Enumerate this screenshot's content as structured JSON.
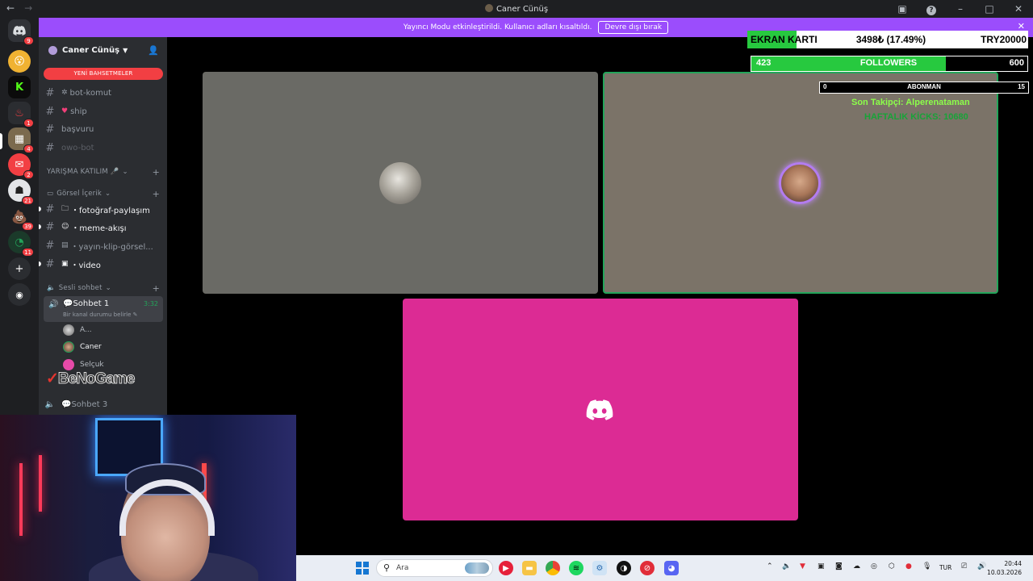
{
  "window": {
    "title": "Caner Cünüş"
  },
  "banner": {
    "message": "Yayıncı Modu etkinleştirildi. Kullanıcı adları kısaltıldı.",
    "button": "Devre dışı bırak"
  },
  "server_rail": {
    "badges": [
      "9",
      "1",
      "4",
      "2",
      "21",
      "39",
      "11"
    ]
  },
  "server": {
    "name": "Caner Cünüş"
  },
  "sidebar": {
    "mentions_pill": "YENİ BAHSETMELER",
    "channels_top": [
      {
        "label": "bot-komut",
        "prefix": "✲"
      },
      {
        "label": "ship",
        "prefix": "♥"
      },
      {
        "label": "başvuru"
      },
      {
        "label": "owo-bot"
      }
    ],
    "category_1": "YARIŞMA KATILIM 🎤",
    "category_2": "Görsel İçerik",
    "channels_visual": [
      {
        "label": "・fotoğraf-paylaşım"
      },
      {
        "label": "・meme-akışı"
      },
      {
        "label": "・yayın-klip-görsel..."
      },
      {
        "label": "・video"
      }
    ],
    "category_3": "Sesli sohbet",
    "voice_active": {
      "name": "Sohbet 1",
      "time": "3:32",
      "status": "Bir kanal durumu belirle ✎"
    },
    "voice_members": [
      "A...",
      "Caner",
      "Selçuk"
    ],
    "voice_other": "Sohbet 3",
    "watermark": "BeNoGame"
  },
  "overlays": {
    "gpu_label": "EKRAN KARTI",
    "gpu_progress_percent": 17.49,
    "gpu_price": "3498₺ (17.49%)",
    "gpu_goal": "TRY20000",
    "followers_current": "423",
    "followers_label": "FOLLOWERS",
    "followers_goal": "600",
    "followers_progress": 0.705,
    "sub_current": "0",
    "sub_label": "ABONMAN",
    "sub_goal": "15",
    "last_follower": "Son Takipçi: Alperenataman",
    "kick_text": "HAFTALIK KİCKS: 10680"
  },
  "taskbar": {
    "search_placeholder": "Ara",
    "language": "TUR",
    "time": "20:44",
    "date": "10.03.2026"
  },
  "colors": {
    "accent": "#9b4dfc",
    "discord_blurple": "#5865f2",
    "speaking": "#23a55a",
    "tile_pink": "#dc2b94",
    "overlay_green": "#27c93f"
  }
}
